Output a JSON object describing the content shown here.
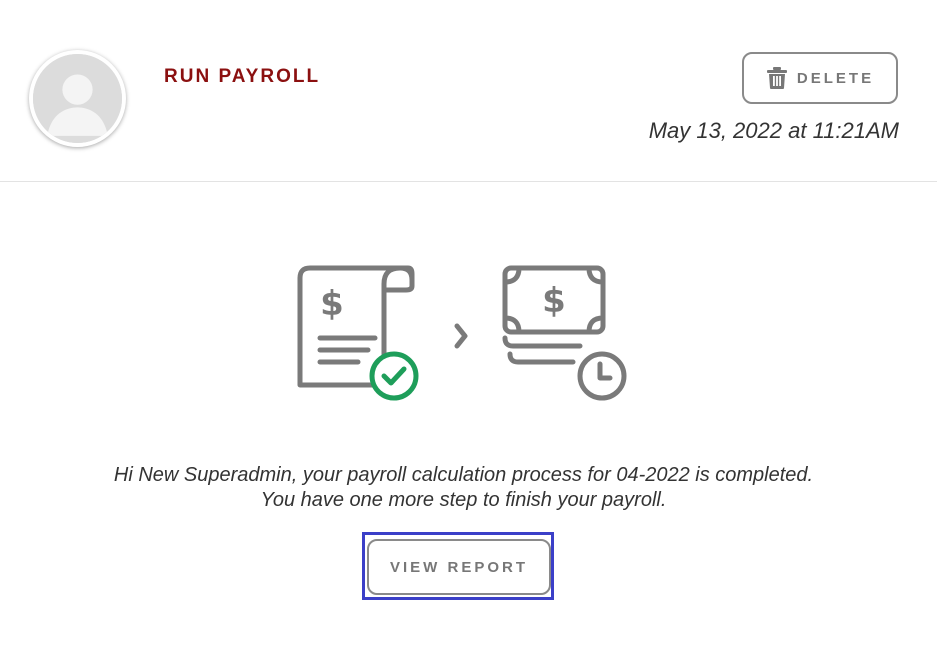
{
  "header": {
    "title": "RUN PAYROLL",
    "delete_label": "DELETE",
    "timestamp": "May 13, 2022 at 11:21AM"
  },
  "illustration": {
    "left_icon": "payroll-document-check-icon",
    "separator_icon": "chevron-right-icon",
    "right_icon": "money-pending-clock-icon",
    "currency_symbol": "$",
    "colors": {
      "icon_gray": "#7a7a7a",
      "check_green": "#1e9e5a"
    }
  },
  "message": {
    "line1": "Hi New Superadmin, your payroll calculation process for 04-2022 is completed.",
    "line2": "You have one more step to finish your payroll."
  },
  "actions": {
    "view_report_label": "VIEW REPORT"
  },
  "colors": {
    "title": "#8b1010",
    "button_border": "#8a8a8a",
    "focus_outline": "#3b3fc8"
  }
}
